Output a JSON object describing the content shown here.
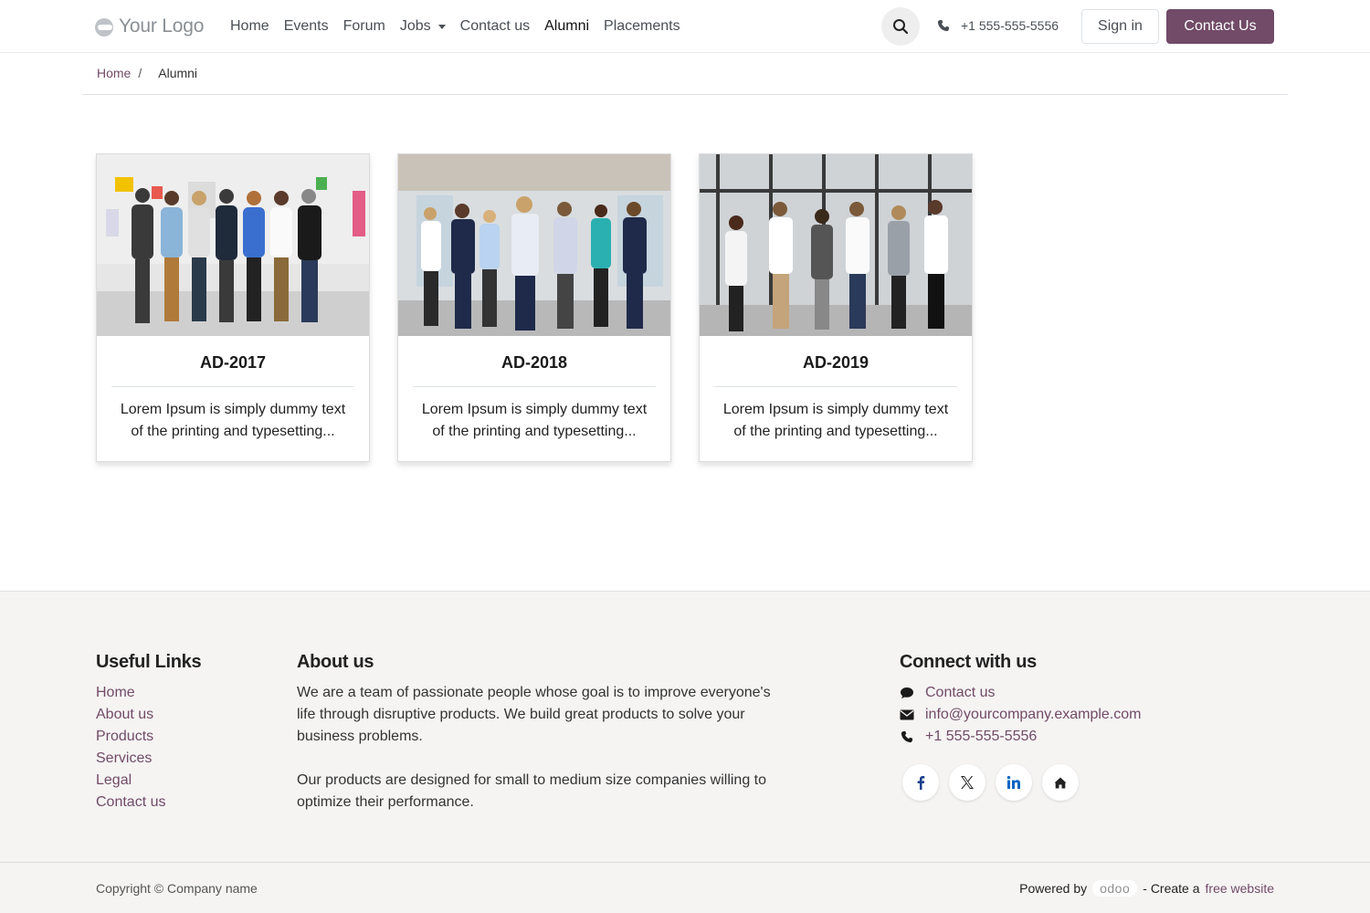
{
  "logo": {
    "text": "Your Logo"
  },
  "nav": {
    "items": [
      {
        "label": "Home"
      },
      {
        "label": "Events"
      },
      {
        "label": "Forum"
      },
      {
        "label": "Jobs"
      },
      {
        "label": "Contact us"
      },
      {
        "label": "Alumni"
      },
      {
        "label": "Placements"
      }
    ],
    "active": "Alumni",
    "phone": "+1 555-555-5556",
    "signin_label": "Sign in",
    "contact_label": "Contact Us"
  },
  "breadcrumb": {
    "home": "Home",
    "separator": "/",
    "current": "Alumni"
  },
  "cards": [
    {
      "title": "AD-2017",
      "desc_line1": "Lorem Ipsum is simply dummy text",
      "desc_line2": "of the printing and typesetting..."
    },
    {
      "title": "AD-2018",
      "desc_line1": "Lorem Ipsum is simply dummy text",
      "desc_line2": "of the printing and typesetting..."
    },
    {
      "title": "AD-2019",
      "desc_line1": "Lorem Ipsum is simply dummy text",
      "desc_line2": "of the printing and typesetting..."
    }
  ],
  "footer": {
    "useful_links": {
      "heading": "Useful Links",
      "items": [
        "Home",
        "About us",
        "Products",
        "Services",
        "Legal",
        "Contact us"
      ]
    },
    "about": {
      "heading": "About us",
      "p1": "We are a team of passionate people whose goal is to improve everyone's life through disruptive products. We build great products to solve your business problems.",
      "p2": "Our products are designed for small to medium size companies willing to optimize their performance."
    },
    "connect": {
      "heading": "Connect with us",
      "contact": "Contact us",
      "email": "info@yourcompany.example.com",
      "phone": "+1 555-555-5556",
      "socials": [
        "facebook-icon",
        "x-icon",
        "linkedin-icon",
        "home-icon"
      ]
    },
    "copyright": "Copyright © Company name",
    "powered_by": "Powered by",
    "odoo": "odoo",
    "create": "- Create a",
    "free_website": "free website"
  },
  "colors": {
    "brand": "#714b67",
    "footer_bg": "#f5f4f3"
  }
}
